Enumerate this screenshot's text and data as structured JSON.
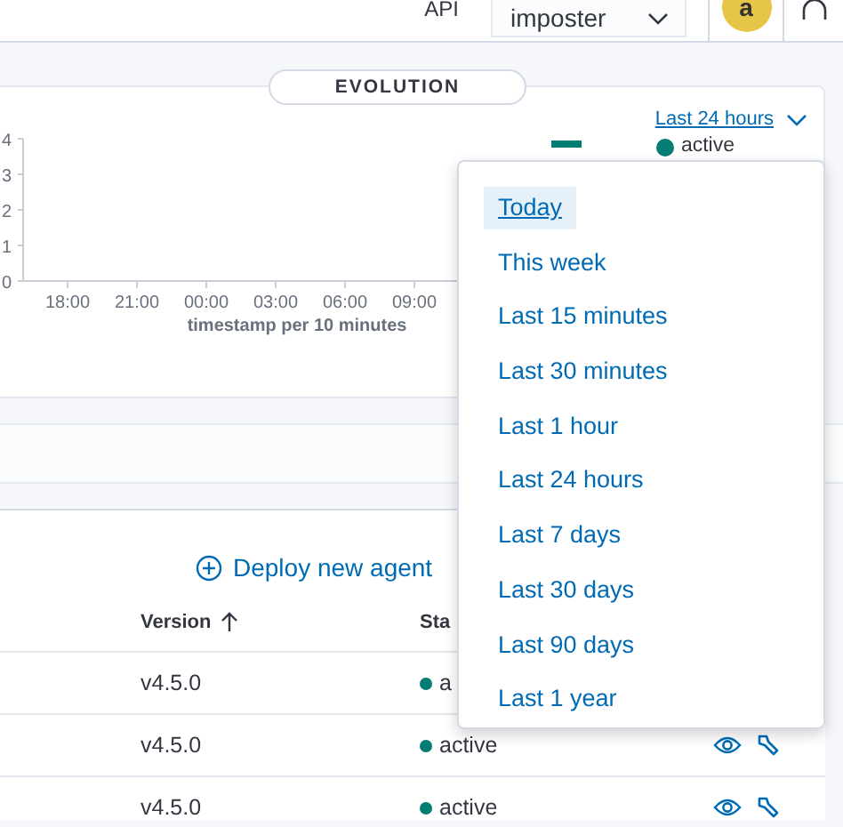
{
  "header": {
    "api_label": "API",
    "select_value": "imposter",
    "avatar_letter": "a"
  },
  "evolution": {
    "title": "EVOLUTION",
    "range_link": "Last 24 hours",
    "chart_data": {
      "type": "line",
      "xlabel": "timestamp per 10 minutes",
      "categories": [
        "18:00",
        "21:00",
        "00:00",
        "03:00",
        "06:00",
        "09:00"
      ],
      "yticks": [
        0,
        1,
        2,
        3,
        4
      ],
      "ylim": [
        0,
        4
      ],
      "series": [
        {
          "name": "active",
          "color": "#017d73",
          "values": [
            null,
            null,
            null,
            null,
            null,
            null
          ]
        }
      ]
    }
  },
  "range_menu": [
    {
      "label": "Today",
      "selected": true
    },
    {
      "label": "This week",
      "selected": false
    },
    {
      "label": "Last 15 minutes",
      "selected": false
    },
    {
      "label": "Last 30 minutes",
      "selected": false
    },
    {
      "label": "Last 1 hour",
      "selected": false
    },
    {
      "label": "Last 24 hours",
      "selected": false
    },
    {
      "label": "Last 7 days",
      "selected": false
    },
    {
      "label": "Last 30 days",
      "selected": false
    },
    {
      "label": "Last 90 days",
      "selected": false
    },
    {
      "label": "Last 1 year",
      "selected": false
    }
  ],
  "agents": {
    "deploy_button": "Deploy new agent",
    "columns": [
      {
        "label": "Version",
        "sorted": true
      },
      {
        "label": "Sta",
        "sorted": false
      }
    ],
    "rows": [
      {
        "version": "v4.5.0",
        "status": "a",
        "actions": false
      },
      {
        "version": "v4.5.0",
        "status": "active",
        "actions": true
      },
      {
        "version": "v4.5.0",
        "status": "active",
        "actions": true
      }
    ]
  }
}
